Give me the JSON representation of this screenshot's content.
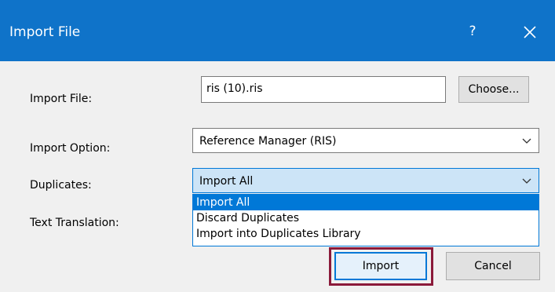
{
  "dialog": {
    "title": "Import File",
    "help_label": "?",
    "icons": {
      "close": "close-icon",
      "dropdown": "chevron-down-icon"
    },
    "colors": {
      "titlebar": "#0f73c9",
      "accent": "#0078d7",
      "focus_border": "#8b1a3a"
    }
  },
  "form": {
    "import_file": {
      "label": "Import File:",
      "value": "ris (10).ris",
      "choose_label": "Choose..."
    },
    "import_option": {
      "label": "Import Option:",
      "selected": "Reference Manager (RIS)"
    },
    "duplicates": {
      "label": "Duplicates:",
      "selected": "Import All",
      "options": [
        "Import All",
        "Discard Duplicates",
        "Import into Duplicates Library"
      ]
    },
    "text_translation": {
      "label": "Text Translation:"
    }
  },
  "actions": {
    "import_label": "Import",
    "cancel_label": "Cancel"
  }
}
